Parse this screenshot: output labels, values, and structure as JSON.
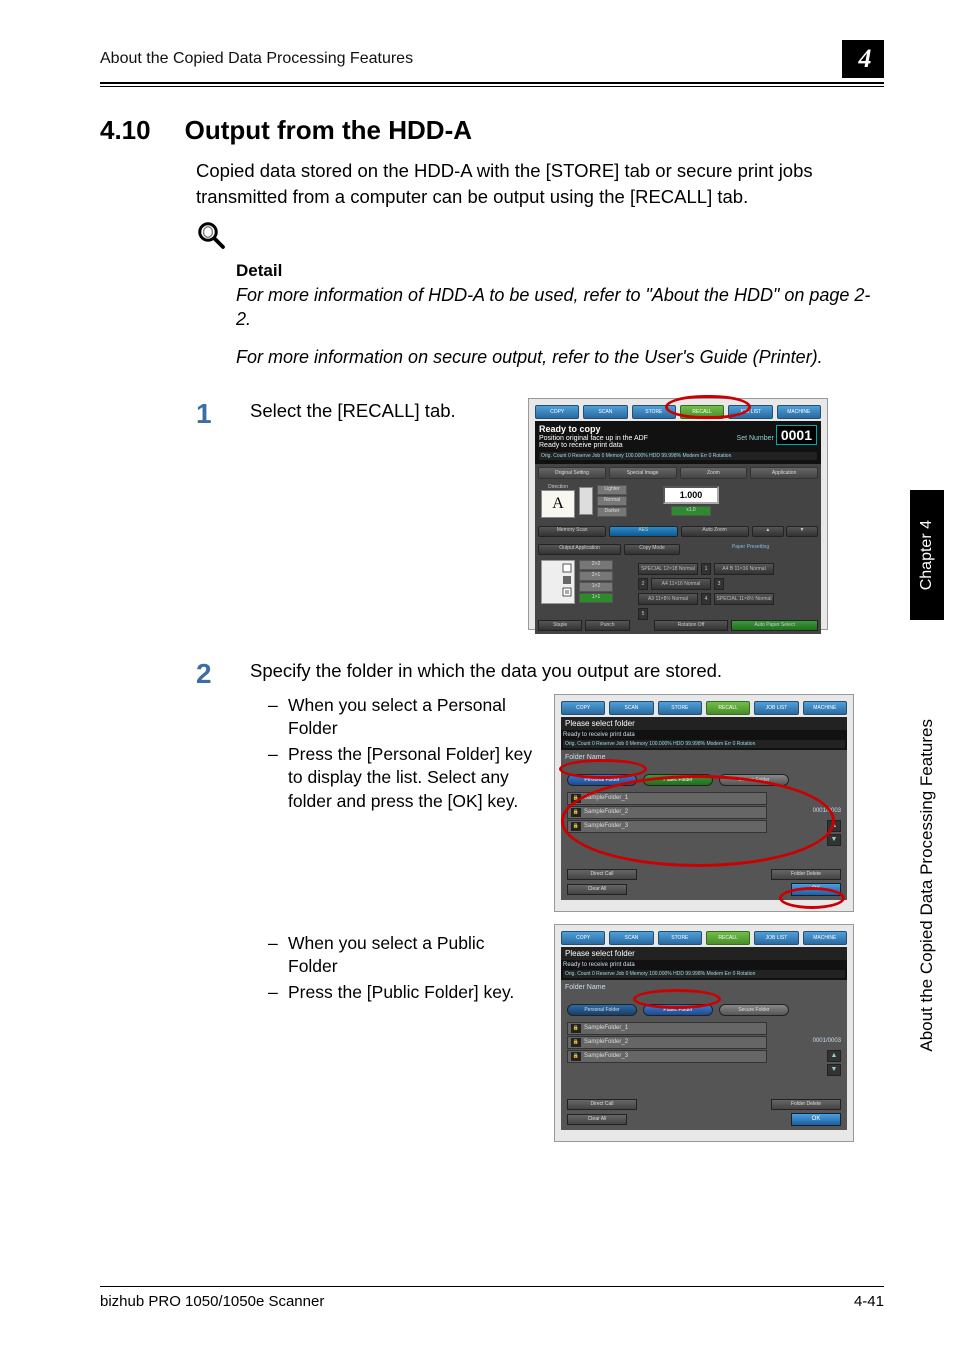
{
  "header": {
    "title": "About the Copied Data Processing Features",
    "chapter_number": "4"
  },
  "section": {
    "number": "4.10",
    "title": "Output from the HDD-A"
  },
  "intro": "Copied data stored on the HDD-A with the [STORE] tab or secure print jobs transmitted from a computer can be output using the [RECALL] tab.",
  "detail": {
    "label": "Detail",
    "para1": "For more information of HDD-A to be used, refer to \"About the HDD\" on page 2-2.",
    "para2": "For more information on secure output, refer to the User's Guide (Printer)."
  },
  "steps": {
    "one": {
      "num": "1",
      "text": "Select the [RECALL] tab."
    },
    "two": {
      "num": "2",
      "text": "Specify the folder in which the data you output are stored.",
      "bullets_a": [
        "When you select a Personal Folder",
        "Press the [Personal Folder] key to display the list. Select any folder and press the [OK] key."
      ],
      "bullets_b": [
        "When you select a Public Folder",
        "Press the [Public Folder] key."
      ]
    }
  },
  "screenshot1": {
    "tabs": [
      "COPY",
      "SCAN",
      "STORE",
      "RECALL",
      "JOB LIST",
      "MACHINE"
    ],
    "ready_line1": "Ready to copy",
    "ready_line2": "Position original face up in the ADF",
    "ready_line3": "Ready to receive print data",
    "set_number_label": "Set Number",
    "set_number": "0001",
    "status": "Orig. Count 0 Reserve Job 0 Memory 100.000% HDD 99.998% Modem Err 0 Rotation",
    "row_labels": [
      "Original Setting",
      "Special Image",
      "Zoom",
      "Application"
    ],
    "direction_label": "Direction",
    "A": "A",
    "density": [
      "Lighter",
      "Normal",
      "Darker"
    ],
    "zoom_value": "1.000",
    "zoom_11": "x1.0",
    "memory_scan": "Memory Scan",
    "aes": "AES",
    "auto_zoom": "Auto Zoom",
    "arrows": [
      "▲",
      "▼"
    ],
    "output_app": "Output Application",
    "copy_mode": "Copy Mode",
    "paper_presetting": "Paper Presetting",
    "copy_modes": [
      "2>2",
      "2>1",
      "1>2",
      "1>1"
    ],
    "papers": [
      "SPECIAL 12×18 Normal",
      "A4 B 11×16 Normal",
      "A4 11×16 Normal",
      "A3 11×8½ Normal",
      "SPECIAL 11×8½ Normal"
    ],
    "paper_numbers": [
      "1",
      "2",
      "3",
      "4",
      "5"
    ],
    "bottom": [
      "Staple",
      "Punch",
      "Rotation Off",
      "Auto Paper Select"
    ]
  },
  "screenshot2": {
    "title": "Please select folder",
    "ready": "Ready to receive print data",
    "status": "Orig. Count 0 Reserve Job 0 Memory 100.000% HDD 99.998% Modem Err 0 Rotation",
    "foldername_label": "Folder Name",
    "tabs": [
      "Personal Folder",
      "Public Folder",
      "Secure Folder"
    ],
    "rows": [
      "SampleFolder_1",
      "SampleFolder_2",
      "SampleFolder_3"
    ],
    "count": "0001/0003",
    "direct": "Direct Call",
    "folder_delete": "Folder Delete",
    "clear": "Clear All",
    "ok": "OK"
  },
  "side": {
    "chapter": "Chapter 4",
    "label": "About the Copied Data Processing Features"
  },
  "footer": {
    "left": "bizhub PRO 1050/1050e Scanner",
    "right": "4-41"
  }
}
